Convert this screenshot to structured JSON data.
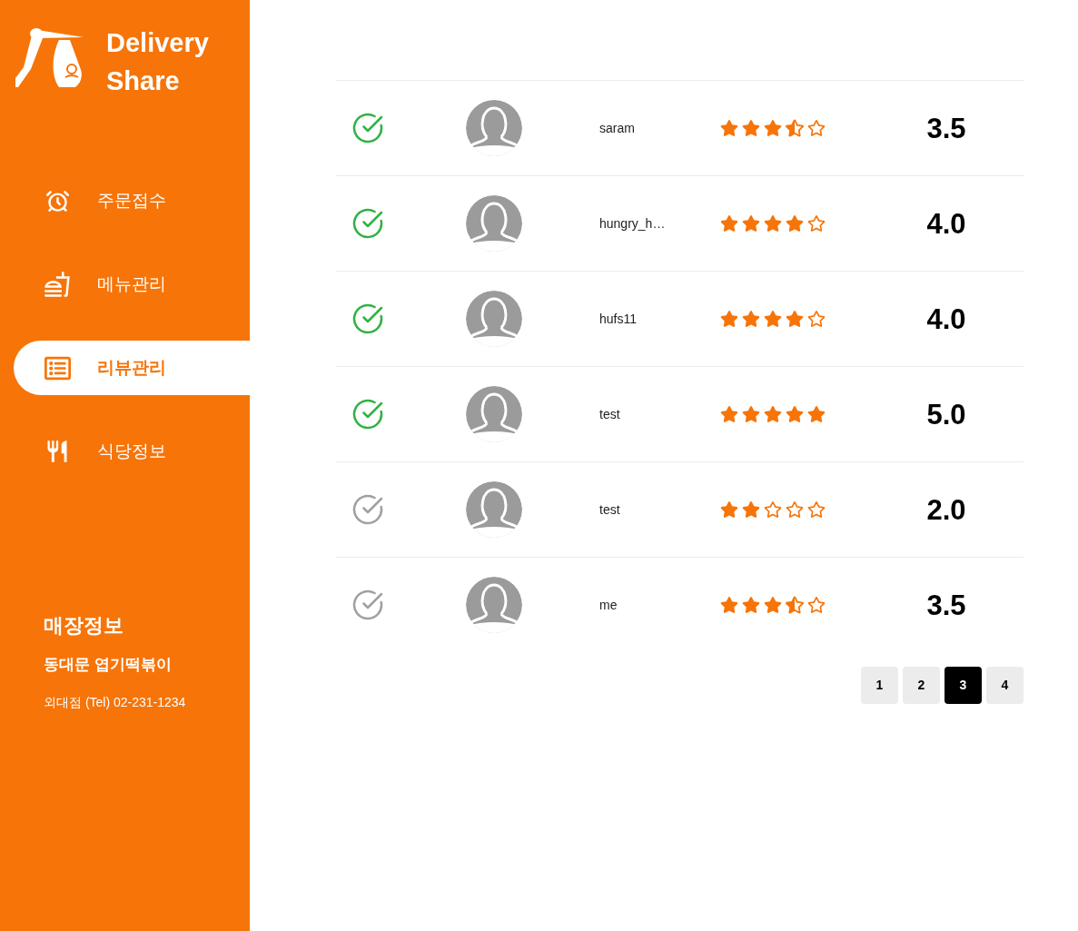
{
  "brand": {
    "title": "Delivery Share"
  },
  "nav": [
    {
      "label": "주문접수",
      "selected": false
    },
    {
      "label": "메뉴관리",
      "selected": false
    },
    {
      "label": "리뷰관리",
      "selected": true
    },
    {
      "label": "식당정보",
      "selected": false
    }
  ],
  "store_info": {
    "heading": "매장정보",
    "name": "동대문 엽기떡볶이",
    "detail": "외대점 (Tel) 02-231-1234"
  },
  "reviews": [
    {
      "checked": true,
      "username": "saram",
      "stars": 3.5,
      "score": "3.5"
    },
    {
      "checked": true,
      "username": "hungry_h…",
      "stars": 4,
      "score": "4.0"
    },
    {
      "checked": true,
      "username": "hufs11",
      "stars": 4,
      "score": "4.0"
    },
    {
      "checked": true,
      "username": "test",
      "stars": 5,
      "score": "5.0"
    },
    {
      "checked": false,
      "username": "test",
      "stars": 2,
      "score": "2.0"
    },
    {
      "checked": false,
      "username": "me",
      "stars": 3.5,
      "score": "3.5"
    }
  ],
  "pagination": [
    {
      "label": "1",
      "selected": false
    },
    {
      "label": "2",
      "selected": false
    },
    {
      "label": "3",
      "selected": true
    },
    {
      "label": "4",
      "selected": false
    }
  ]
}
